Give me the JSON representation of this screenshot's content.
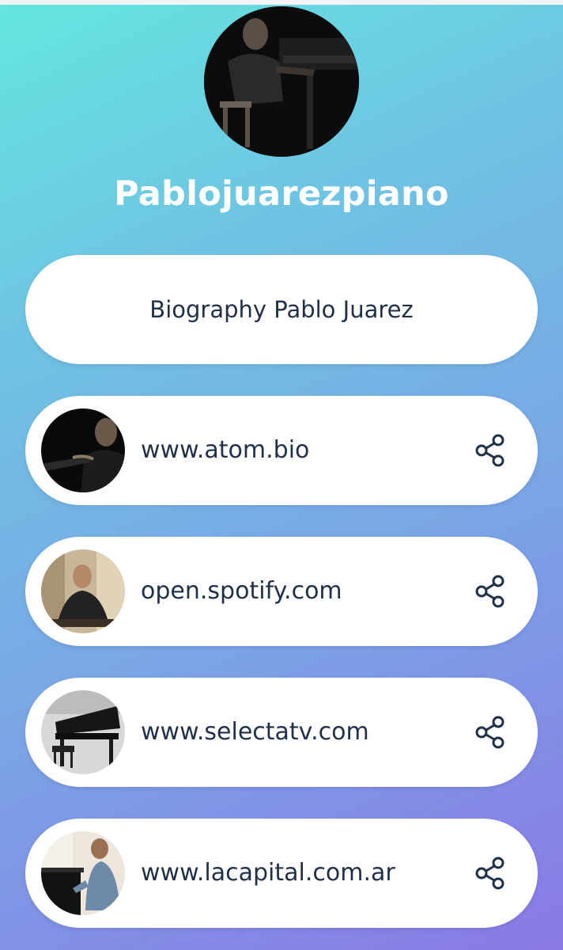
{
  "profile": {
    "name": "Pablojuarezpiano"
  },
  "links": [
    {
      "label": "Biography Pablo Juarez"
    },
    {
      "label": "www.atom.bio",
      "thumb_icon": "pianist-dark-photo",
      "action_icon": "share-icon"
    },
    {
      "label": "open.spotify.com",
      "thumb_icon": "portrait-photo",
      "action_icon": "share-icon"
    },
    {
      "label": "www.selectatv.com",
      "thumb_icon": "grand-piano-photo",
      "action_icon": "share-icon"
    },
    {
      "label": "www.lacapital.com.ar",
      "thumb_icon": "pianist-playing-photo",
      "action_icon": "share-icon"
    }
  ],
  "colors": {
    "gradient_start": "#64e6df",
    "gradient_end": "#8a79e4",
    "text_dark": "#1f3048",
    "pill_bg": "#ffffff"
  }
}
